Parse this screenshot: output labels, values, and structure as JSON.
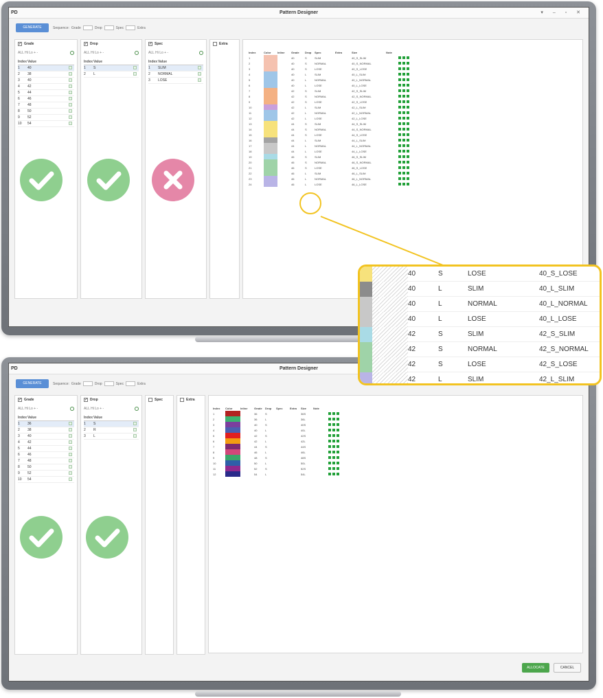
{
  "common": {
    "app_label": "PD",
    "window_title": "Pattern Designer",
    "window_controls": "▾ – ▫ ✕",
    "generate_label": "GENERATE",
    "sequence_label": "Sequence:",
    "seq_items": [
      "Grade",
      "Drop",
      "Spec",
      "Extra"
    ]
  },
  "top": {
    "panels": [
      {
        "title": "Grade",
        "filter": "ALL  Hi  Lo  +  -",
        "col_index": "Index",
        "col_value": "Value",
        "rows": [
          [
            "1",
            "40"
          ],
          [
            "2",
            "38"
          ],
          [
            "3",
            "40"
          ],
          [
            "4",
            "42"
          ],
          [
            "5",
            "44"
          ],
          [
            "6",
            "46"
          ],
          [
            "7",
            "48"
          ],
          [
            "8",
            "50"
          ],
          [
            "9",
            "52"
          ],
          [
            "10",
            "54"
          ]
        ]
      },
      {
        "title": "Drop",
        "filter": "ALL  Hi  Lo  +  -",
        "col_index": "Index",
        "col_value": "Value",
        "rows": [
          [
            "1",
            "S"
          ],
          [
            "2",
            "L"
          ]
        ]
      },
      {
        "title": "Spec",
        "filter": "ALL  Hi  Lo  +  -",
        "col_index": "Index",
        "col_value": "Value",
        "rows": [
          [
            "1",
            "SLIM"
          ],
          [
            "2",
            "NORMAL"
          ],
          [
            "3",
            "LOSE"
          ]
        ]
      },
      {
        "title": "Extra"
      }
    ],
    "table_headers": [
      "Index",
      "Color",
      "Inline",
      "Grade",
      "Drop",
      "Spec",
      "Extra",
      "Size",
      "Note"
    ],
    "table_rows": [
      [
        "1",
        "40",
        "S",
        "SLIM",
        "40_S_SLIM"
      ],
      [
        "2",
        "40",
        "S",
        "NORMAL",
        "40_S_NORMAL"
      ],
      [
        "3",
        "40",
        "S",
        "LOSE",
        "40_S_LOSE"
      ],
      [
        "4",
        "40",
        "L",
        "SLIM",
        "40_L_SLIM"
      ],
      [
        "5",
        "40",
        "L",
        "NORMAL",
        "40_L_NORMAL"
      ],
      [
        "6",
        "40",
        "L",
        "LOSE",
        "40_L_LOSE"
      ],
      [
        "7",
        "42",
        "S",
        "SLIM",
        "42_S_SLIM"
      ],
      [
        "8",
        "42",
        "S",
        "NORMAL",
        "42_S_NORMAL"
      ],
      [
        "9",
        "42",
        "S",
        "LOSE",
        "42_S_LOSE"
      ],
      [
        "10",
        "42",
        "L",
        "SLIM",
        "42_L_SLIM"
      ],
      [
        "11",
        "42",
        "L",
        "NORMAL",
        "42_L_NORMAL"
      ],
      [
        "12",
        "42",
        "L",
        "LOSE",
        "42_L_LOSE"
      ],
      [
        "13",
        "44",
        "S",
        "SLIM",
        "44_S_SLIM"
      ],
      [
        "14",
        "44",
        "S",
        "NORMAL",
        "44_S_NORMAL"
      ],
      [
        "15",
        "44",
        "S",
        "LOSE",
        "44_S_LOSE"
      ],
      [
        "16",
        "44",
        "L",
        "SLIM",
        "44_L_SLIM"
      ],
      [
        "17",
        "44",
        "L",
        "NORMAL",
        "44_L_NORMAL"
      ],
      [
        "18",
        "44",
        "L",
        "LOSE",
        "44_L_LOSE"
      ],
      [
        "19",
        "46",
        "S",
        "SLIM",
        "46_S_SLIM"
      ],
      [
        "20",
        "46",
        "S",
        "NORMAL",
        "46_S_NORMAL"
      ],
      [
        "21",
        "46",
        "S",
        "LOSE",
        "46_S_LOSE"
      ],
      [
        "22",
        "46",
        "L",
        "SLIM",
        "46_L_SLIM"
      ],
      [
        "23",
        "46",
        "L",
        "NORMAL",
        "46_L_NORMAL"
      ],
      [
        "24",
        "46",
        "L",
        "LOSE",
        "46_L_LOSE"
      ]
    ],
    "row_colors": [
      "#f5c2b0",
      "#f5c2b0",
      "#f5c2b0",
      "#9fc6e8",
      "#9fc6e8",
      "#9fc6e8",
      "#f4b183",
      "#f4b183",
      "#f4b183",
      "#c9a0dc",
      "#9fc6e8",
      "#9fc6e8",
      "#f7e27c",
      "#f7e27c",
      "#f7e27c",
      "#a3a3a3",
      "#c8c8c8",
      "#c8c8c8",
      "#a9dbe6",
      "#9fd3a8",
      "#9fd3a8",
      "#9fd3a8",
      "#b9b4e6",
      "#b9b4e6"
    ]
  },
  "magnifier": {
    "rows": [
      {
        "color": "#f7e27c",
        "grade": "40",
        "drop": "S",
        "spec": "LOSE",
        "size": "40_S_LOSE"
      },
      {
        "color": "#8c8c8c",
        "grade": "40",
        "drop": "L",
        "spec": "SLIM",
        "size": "40_L_SLIM"
      },
      {
        "color": "#c8c8c8",
        "grade": "40",
        "drop": "L",
        "spec": "NORMAL",
        "size": "40_L_NORMAL"
      },
      {
        "color": "#c8c8c8",
        "grade": "40",
        "drop": "L",
        "spec": "LOSE",
        "size": "40_L_LOSE"
      },
      {
        "color": "#a9dbe6",
        "grade": "42",
        "drop": "S",
        "spec": "SLIM",
        "size": "42_S_SLIM"
      },
      {
        "color": "#9fd3a8",
        "grade": "42",
        "drop": "S",
        "spec": "NORMAL",
        "size": "42_S_NORMAL"
      },
      {
        "color": "#9fd3a8",
        "grade": "42",
        "drop": "S",
        "spec": "LOSE",
        "size": "42_S_LOSE"
      },
      {
        "color": "#b9b4e6",
        "grade": "42",
        "drop": "L",
        "spec": "SLIM",
        "size": "42_L_SLIM"
      }
    ]
  },
  "bottom": {
    "panels": [
      {
        "title": "Grade",
        "filter": "ALL  Hi  Lo  +  -",
        "col_index": "Index",
        "col_value": "Value",
        "rows": [
          [
            "1",
            "36"
          ],
          [
            "2",
            "38"
          ],
          [
            "3",
            "40"
          ],
          [
            "4",
            "42"
          ],
          [
            "5",
            "44"
          ],
          [
            "6",
            "46"
          ],
          [
            "7",
            "48"
          ],
          [
            "8",
            "50"
          ],
          [
            "9",
            "52"
          ],
          [
            "10",
            "54"
          ]
        ]
      },
      {
        "title": "Drop",
        "filter": "ALL  Hi  Lo  +  -",
        "col_index": "Index",
        "col_value": "Value",
        "rows": [
          [
            "1",
            "S"
          ],
          [
            "2",
            "R"
          ],
          [
            "3",
            "L"
          ]
        ]
      },
      {
        "title": "Spec"
      },
      {
        "title": "Extra"
      }
    ],
    "table_headers": [
      "Index",
      "Color",
      "Inline",
      "Grade",
      "Drop",
      "Spec",
      "Extra",
      "Size",
      "Note"
    ],
    "table_rows": [
      [
        "1",
        "36",
        "S",
        "36S"
      ],
      [
        "2",
        "36",
        "L",
        "36L"
      ],
      [
        "3",
        "40",
        "S",
        "40S"
      ],
      [
        "4",
        "40",
        "L",
        "40L"
      ],
      [
        "5",
        "42",
        "S",
        "42S"
      ],
      [
        "6",
        "42",
        "L",
        "42L"
      ],
      [
        "7",
        "44",
        "S",
        "44S"
      ],
      [
        "8",
        "46",
        "L",
        "46L"
      ],
      [
        "9",
        "48",
        "S",
        "48S"
      ],
      [
        "10",
        "50",
        "L",
        "50L"
      ],
      [
        "11",
        "52",
        "S",
        "52S"
      ],
      [
        "12",
        "54",
        "L",
        "54L"
      ]
    ],
    "row_colors": [
      "#b22222",
      "#3cb371",
      "#7b3f9e",
      "#4a5fb0",
      "#e02020",
      "#f39c12",
      "#7f2a6f",
      "#d1477a",
      "#3aa66a",
      "#2f5fa8",
      "#8e2a8e",
      "#2a2a8a"
    ],
    "ok_label": "ALLOCATE",
    "cancel_label": "CANCEL"
  },
  "colors": {
    "accent": "#5a8fd6",
    "ok_green": "#8fcf8f",
    "reject_pink": "#e587a8",
    "highlight": "#f2c320",
    "status_green": "#21a038"
  }
}
